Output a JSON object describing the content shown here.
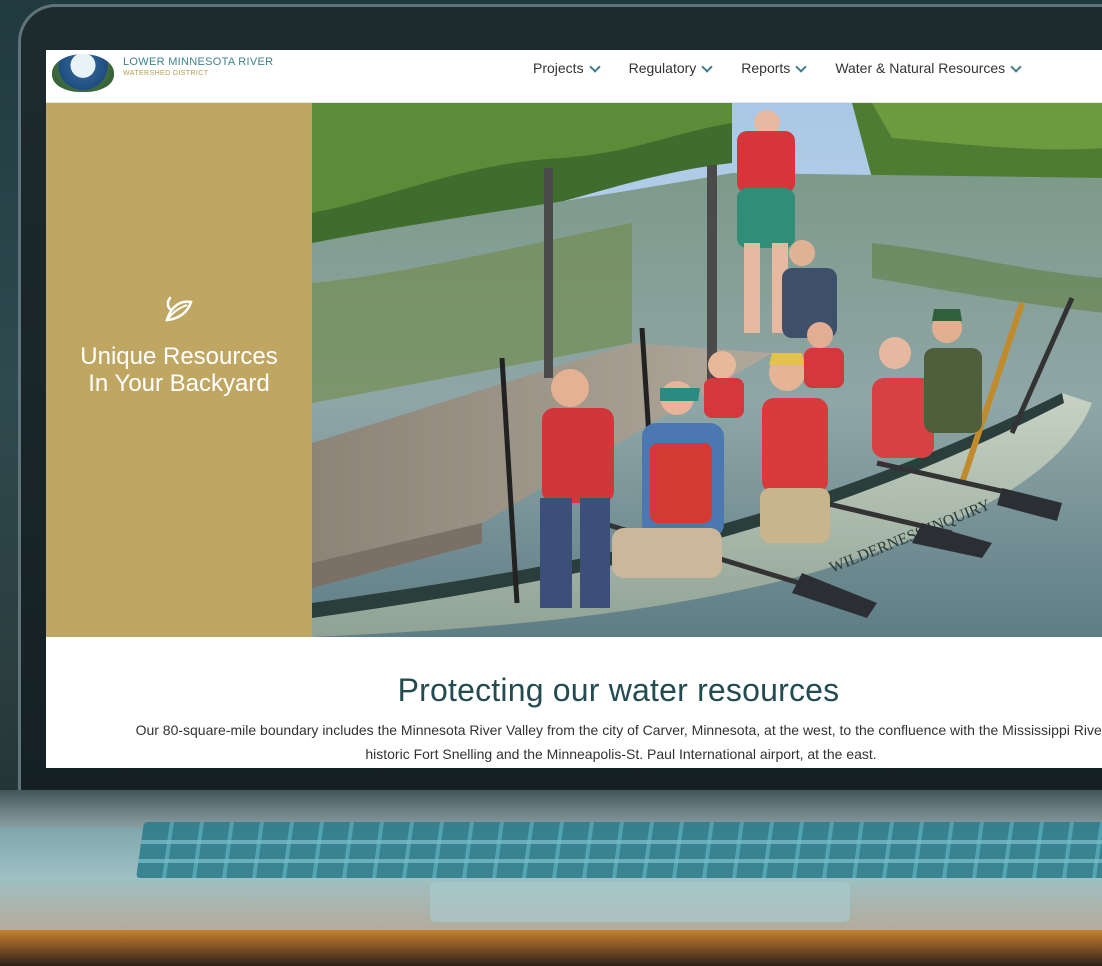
{
  "site": {
    "logo_line1": "LOWER MINNESOTA RIVER",
    "logo_line2": "WATERSHED DISTRICT"
  },
  "nav": {
    "items": [
      {
        "label": "Projects"
      },
      {
        "label": "Regulatory"
      },
      {
        "label": "Reports"
      },
      {
        "label": "Water & Natural Resources"
      }
    ]
  },
  "hero": {
    "title_line1": "Unique Resources",
    "title_line2": "In Your Backyard",
    "canoe_text": "WILDERNESS INQUIRY",
    "colors": {
      "panel": "#bfa763",
      "title": "#ffffff"
    }
  },
  "intro": {
    "heading": "Protecting our water resources",
    "body_line1": "Our 80-square-mile boundary includes the Minnesota River Valley from the city of Carver, Minnesota, at the west, to the confluence with the Mississippi River",
    "body_line2": "historic Fort Snelling and the Minneapolis-St. Paul International airport, at the east."
  }
}
